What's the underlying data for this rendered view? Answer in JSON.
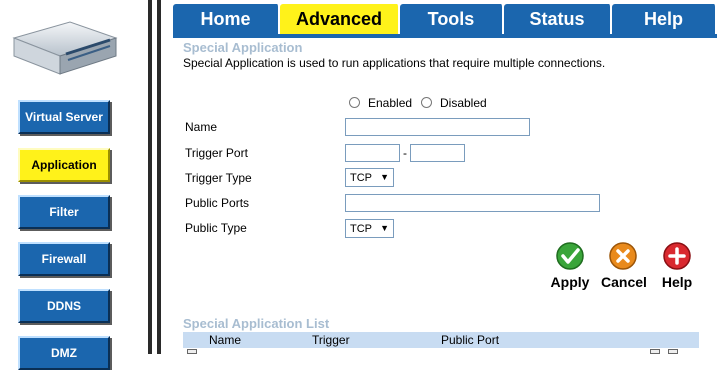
{
  "tabs": [
    "Home",
    "Advanced",
    "Tools",
    "Status",
    "Help"
  ],
  "active_tab": "Advanced",
  "sidebar": {
    "items": [
      {
        "label": "Virtual Server"
      },
      {
        "label": "Application"
      },
      {
        "label": "Filter"
      },
      {
        "label": "Firewall"
      },
      {
        "label": "DDNS"
      },
      {
        "label": "DMZ"
      }
    ],
    "active": "Application"
  },
  "section": {
    "title": "Special Application",
    "description": "Special Application is used to run applications that require multiple connections."
  },
  "form": {
    "enabled_label": "Enabled",
    "disabled_label": "Disabled",
    "name_label": "Name",
    "name_value": "",
    "trigger_port_label": "Trigger Port",
    "trigger_port_from": "",
    "trigger_port_to": "",
    "trigger_port_separator": "-",
    "trigger_type_label": "Trigger Type",
    "trigger_type_value": "TCP",
    "public_ports_label": "Public Ports",
    "public_ports_value": "",
    "public_type_label": "Public Type",
    "public_type_value": "TCP"
  },
  "actions": {
    "apply": "Apply",
    "cancel": "Cancel",
    "help": "Help"
  },
  "list": {
    "title": "Special Application List",
    "columns": [
      "Name",
      "Trigger",
      "Public Port"
    ]
  },
  "colors": {
    "nav_blue": "#1b66ae",
    "active_yellow": "#fff21a",
    "section_title": "#a8bdd1",
    "list_header": "#c8dcf2"
  }
}
